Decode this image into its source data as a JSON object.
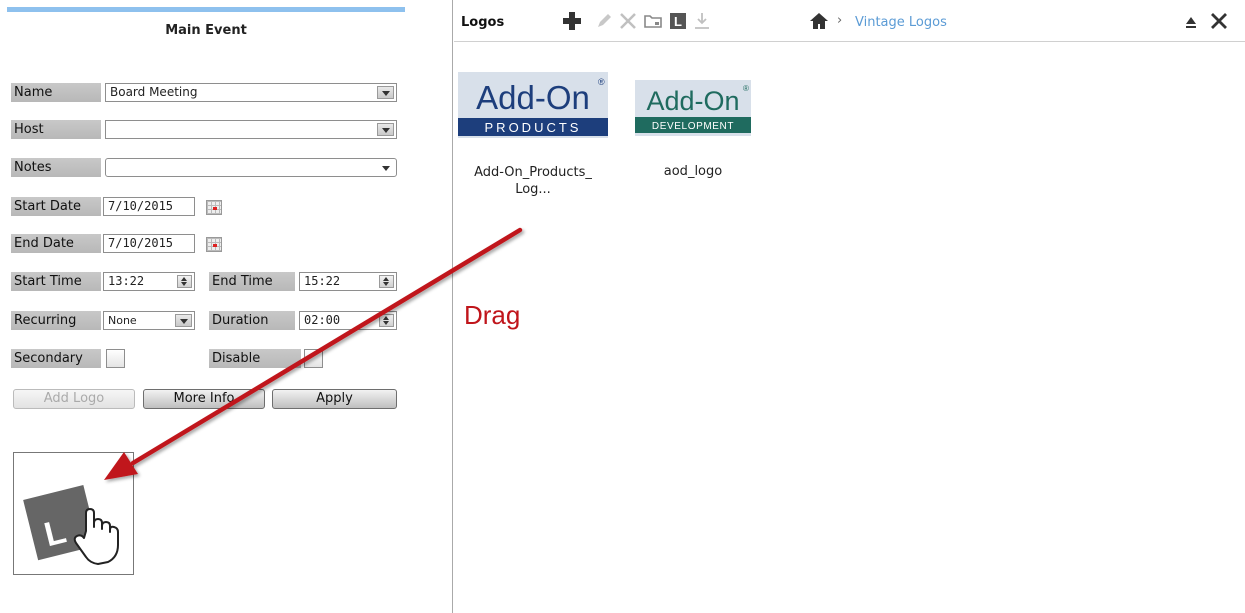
{
  "main_event": {
    "title": "Main Event",
    "fields": {
      "name_label": "Name",
      "name_value": "Board Meeting",
      "host_label": "Host",
      "host_value": "",
      "notes_label": "Notes",
      "notes_value": "",
      "start_date_label": "Start Date",
      "start_date_value": "7/10/2015",
      "end_date_label": "End Date",
      "end_date_value": "7/10/2015",
      "start_time_label": "Start Time",
      "start_time_value": "13:22",
      "end_time_label": "End Time",
      "end_time_value": "15:22",
      "recurring_label": "Recurring",
      "recurring_value": "None",
      "duration_label": "Duration",
      "duration_value": "02:00",
      "secondary_label": "Secondary",
      "disable_label": "Disable"
    },
    "buttons": {
      "add_logo": "Add Logo",
      "more_info": "More Info",
      "apply": "Apply"
    }
  },
  "logos_panel": {
    "title": "Logos",
    "toolbar_icons": [
      "plus-icon",
      "pencil-icon",
      "close-x-icon",
      "folder-icon",
      "logo-L-icon",
      "download-icon"
    ],
    "breadcrumb": {
      "home_icon": "home-icon",
      "separator": "›",
      "current": "Vintage Logos"
    },
    "tiles": [
      {
        "caption": "Add-On_Products_Log...",
        "logo_text_top": "Add-On",
        "logo_text_bottom": "PRODUCTS",
        "logo_reg": "®"
      },
      {
        "caption": "aod_logo",
        "logo_text_top": "Add-On",
        "logo_text_bottom": "DEVELOPMENT",
        "logo_reg": "®"
      }
    ],
    "annotation": "Drag"
  },
  "colors": {
    "accent_blue": "#8ec1ee",
    "link_blue": "#5b9bd5",
    "arrow_red": "#c0151b",
    "logo_navy": "#1d3e7c",
    "logo_teal": "#1f6b5f",
    "logo_bg": "#d8e0ea"
  }
}
